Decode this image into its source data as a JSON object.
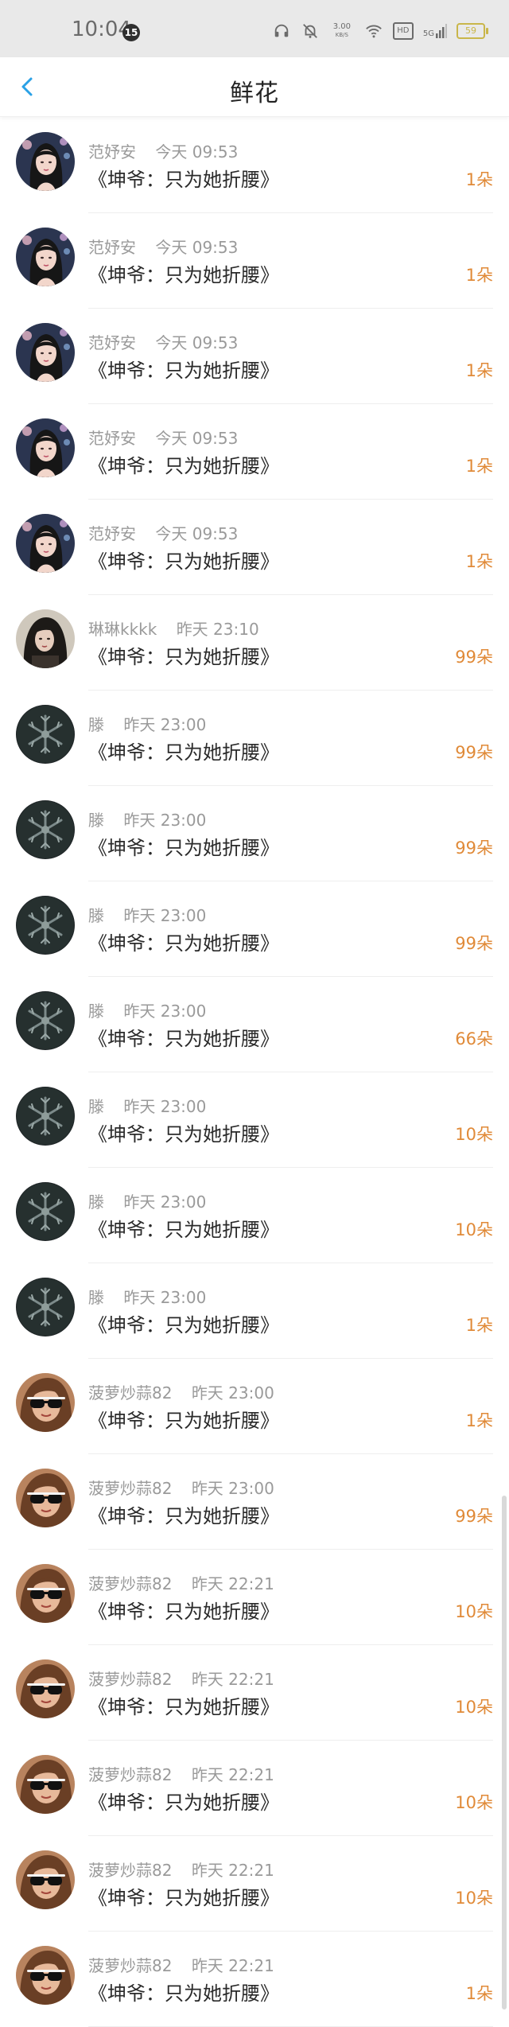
{
  "status_bar": {
    "time": "10:04",
    "notification_count": "15",
    "net_speed_value": "3.00",
    "net_speed_unit": "KB/S",
    "network_type": "HD",
    "signal_label": "5G",
    "battery_level": "59"
  },
  "header": {
    "title": "鲜花"
  },
  "items": [
    {
      "user": "范妤安",
      "time": "今天 09:53",
      "book": "《坤爷：只为她折腰》",
      "count": "1朵",
      "avatar": "portrait"
    },
    {
      "user": "范妤安",
      "time": "今天 09:53",
      "book": "《坤爷：只为她折腰》",
      "count": "1朵",
      "avatar": "portrait"
    },
    {
      "user": "范妤安",
      "time": "今天 09:53",
      "book": "《坤爷：只为她折腰》",
      "count": "1朵",
      "avatar": "portrait"
    },
    {
      "user": "范妤安",
      "time": "今天 09:53",
      "book": "《坤爷：只为她折腰》",
      "count": "1朵",
      "avatar": "portrait"
    },
    {
      "user": "范妤安",
      "time": "今天 09:53",
      "book": "《坤爷：只为她折腰》",
      "count": "1朵",
      "avatar": "portrait"
    },
    {
      "user": "琳琳kkkk",
      "time": "昨天 23:10",
      "book": "《坤爷：只为她折腰》",
      "count": "99朵",
      "avatar": "portrait-dark"
    },
    {
      "user": "滕",
      "time": "昨天 23:00",
      "book": "《坤爷：只为她折腰》",
      "count": "99朵",
      "avatar": "snowflake"
    },
    {
      "user": "滕",
      "time": "昨天 23:00",
      "book": "《坤爷：只为她折腰》",
      "count": "99朵",
      "avatar": "snowflake"
    },
    {
      "user": "滕",
      "time": "昨天 23:00",
      "book": "《坤爷：只为她折腰》",
      "count": "99朵",
      "avatar": "snowflake"
    },
    {
      "user": "滕",
      "time": "昨天 23:00",
      "book": "《坤爷：只为她折腰》",
      "count": "66朵",
      "avatar": "snowflake"
    },
    {
      "user": "滕",
      "time": "昨天 23:00",
      "book": "《坤爷：只为她折腰》",
      "count": "10朵",
      "avatar": "snowflake"
    },
    {
      "user": "滕",
      "time": "昨天 23:00",
      "book": "《坤爷：只为她折腰》",
      "count": "10朵",
      "avatar": "snowflake"
    },
    {
      "user": "滕",
      "time": "昨天 23:00",
      "book": "《坤爷：只为她折腰》",
      "count": "1朵",
      "avatar": "snowflake"
    },
    {
      "user": "菠萝炒蒜82",
      "time": "昨天 23:00",
      "book": "《坤爷：只为她折腰》",
      "count": "1朵",
      "avatar": "sunglasses"
    },
    {
      "user": "菠萝炒蒜82",
      "time": "昨天 23:00",
      "book": "《坤爷：只为她折腰》",
      "count": "99朵",
      "avatar": "sunglasses"
    },
    {
      "user": "菠萝炒蒜82",
      "time": "昨天 22:21",
      "book": "《坤爷：只为她折腰》",
      "count": "10朵",
      "avatar": "sunglasses"
    },
    {
      "user": "菠萝炒蒜82",
      "time": "昨天 22:21",
      "book": "《坤爷：只为她折腰》",
      "count": "10朵",
      "avatar": "sunglasses"
    },
    {
      "user": "菠萝炒蒜82",
      "time": "昨天 22:21",
      "book": "《坤爷：只为她折腰》",
      "count": "10朵",
      "avatar": "sunglasses"
    },
    {
      "user": "菠萝炒蒜82",
      "time": "昨天 22:21",
      "book": "《坤爷：只为她折腰》",
      "count": "10朵",
      "avatar": "sunglasses"
    },
    {
      "user": "菠萝炒蒜82",
      "time": "昨天 22:21",
      "book": "《坤爷：只为她折腰》",
      "count": "1朵",
      "avatar": "sunglasses"
    }
  ],
  "colors": {
    "accent": "#2aa1e6",
    "count_orange": "#e08a38",
    "meta_gray": "#9a9a9a",
    "title_text": "#222222"
  }
}
